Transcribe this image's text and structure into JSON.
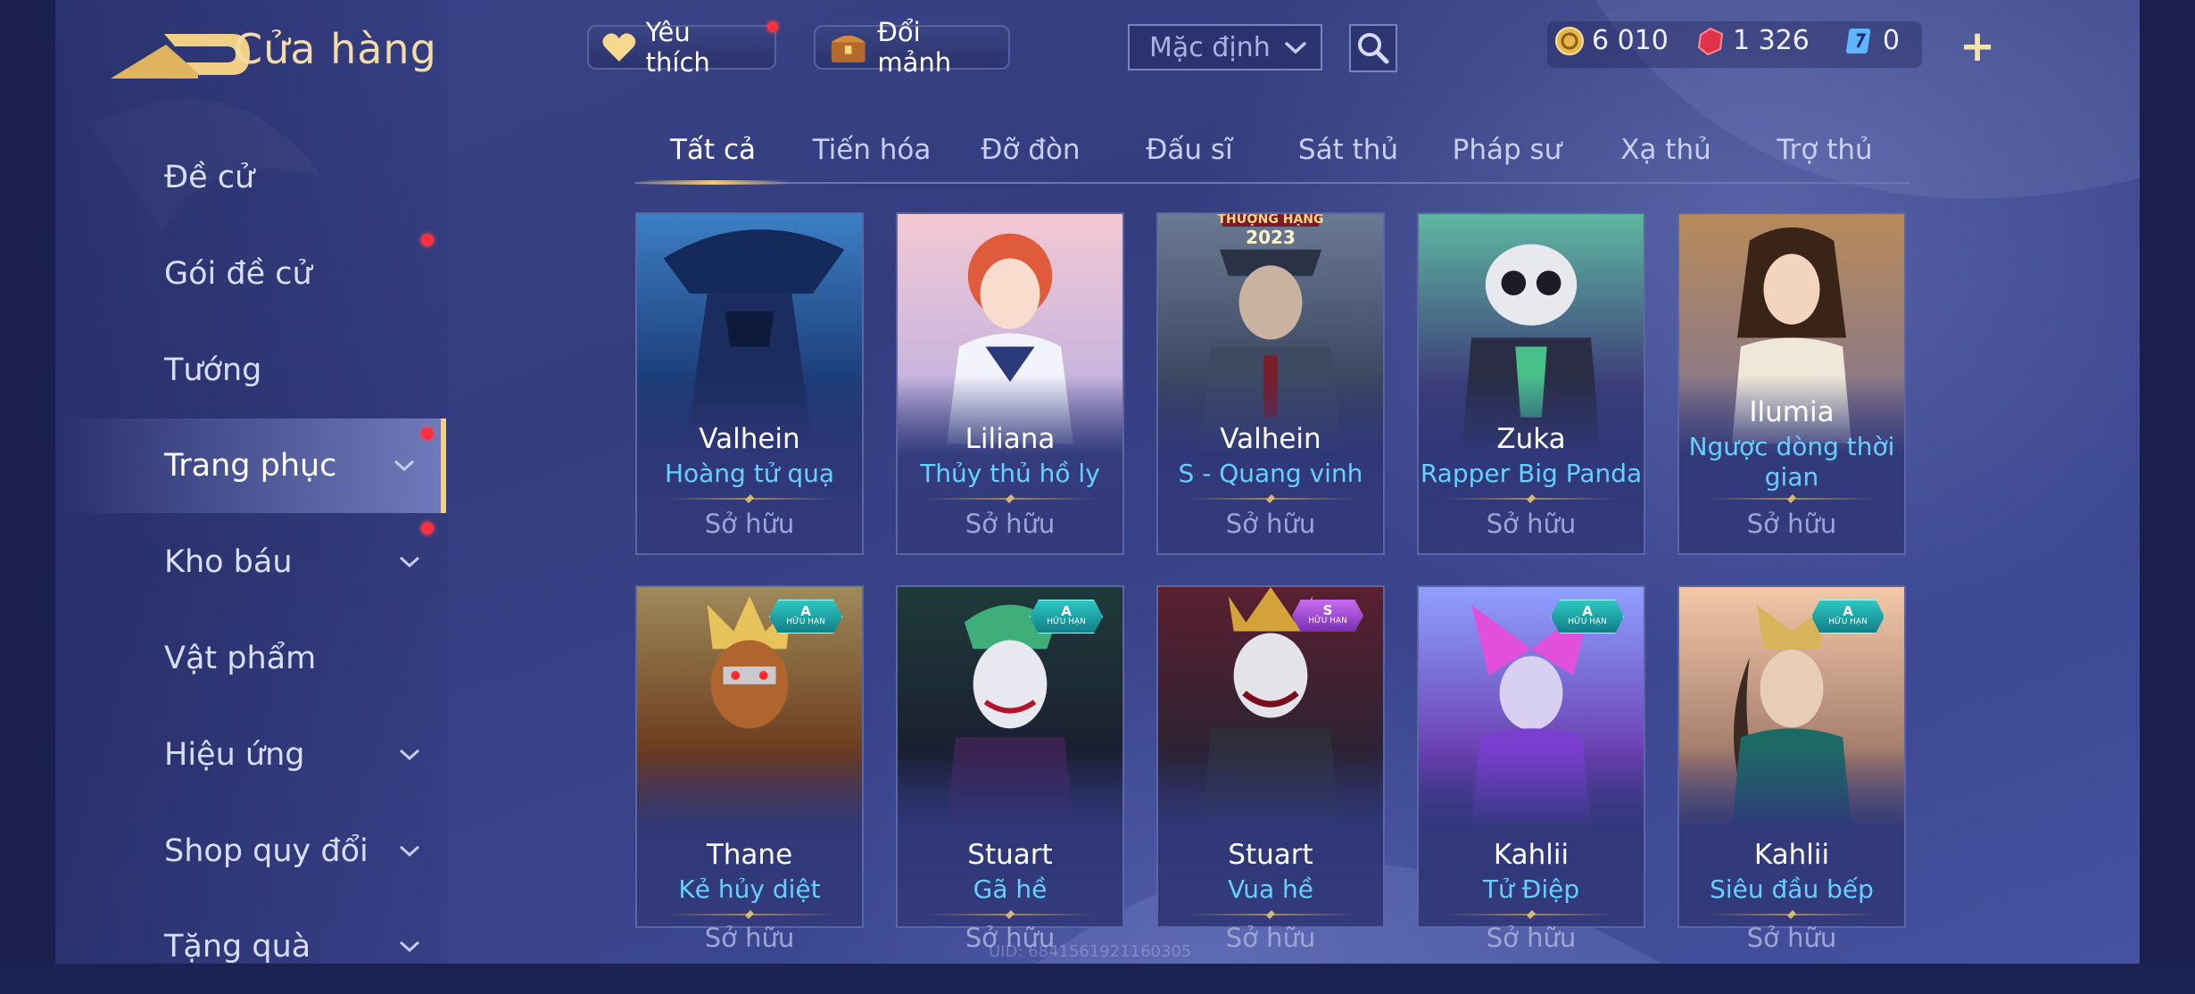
{
  "header": {
    "title": "Cửa hàng",
    "favorites_label": "Yêu thích",
    "shards_label": "Đổi mảnh",
    "sort_value": "Mặc định",
    "currencies": [
      {
        "icon": "gold-coin-icon",
        "value": "6 010"
      },
      {
        "icon": "ruby-gem-icon",
        "value": "1 326"
      },
      {
        "icon": "voucher-icon",
        "value": "0"
      }
    ]
  },
  "sidebar": {
    "items": [
      {
        "label": "Đề cử"
      },
      {
        "label": "Gói đề cử"
      },
      {
        "label": "Tướng"
      },
      {
        "label": "Trang phục"
      },
      {
        "label": "Kho báu"
      },
      {
        "label": "Vật phẩm"
      },
      {
        "label": "Hiệu ứng"
      },
      {
        "label": "Shop quy đổi"
      },
      {
        "label": "Tặng quà"
      }
    ]
  },
  "tabs": [
    "Tất cả",
    "Tiến hóa",
    "Đỡ đòn",
    "Đấu sĩ",
    "Sát thủ",
    "Pháp sư",
    "Xạ thủ",
    "Trợ thủ"
  ],
  "cards": [
    {
      "hero": "Valhein",
      "skin": "Hoàng tử quạ",
      "status": "Sở hữu"
    },
    {
      "hero": "Liliana",
      "skin": "Thủy thủ hồ ly",
      "status": "Sở hữu"
    },
    {
      "hero": "Valhein",
      "skin": "S - Quang vinh",
      "status": "Sở hữu",
      "banner_top": "THƯỢNG HẠNG",
      "banner_year": "2023"
    },
    {
      "hero": "Zuka",
      "skin": "Rapper Big Panda",
      "status": "Sở hữu"
    },
    {
      "hero": "Ilumia",
      "skin": "Ngược dòng thời gian",
      "status": "Sở hữu"
    },
    {
      "hero": "Thane",
      "skin": "Kẻ hủy diệt",
      "status": "Sở hữu",
      "grade": "A",
      "limit": "HỮU HẠN"
    },
    {
      "hero": "Stuart",
      "skin": "Gã hề",
      "status": "Sở hữu",
      "grade": "A",
      "limit": "HỮU HẠN"
    },
    {
      "hero": "Stuart",
      "skin": "Vua hề",
      "status": "Sở hữu",
      "grade": "S",
      "limit": "HỮU HẠN"
    },
    {
      "hero": "Kahlii",
      "skin": "Tử Điệp",
      "status": "Sở hữu",
      "grade": "A",
      "limit": "HỮU HẠN"
    },
    {
      "hero": "Kahlii",
      "skin": "Siêu đầu bếp",
      "status": "Sở hữu",
      "grade": "A",
      "limit": "HỮU HẠN"
    }
  ],
  "footer": {
    "uid": "UID: 6841561921160305"
  },
  "colors": {
    "accent_gold": "#f3dca7",
    "skin_name_blue": "#66d0ff",
    "notification_red": "#ff2f3f"
  }
}
